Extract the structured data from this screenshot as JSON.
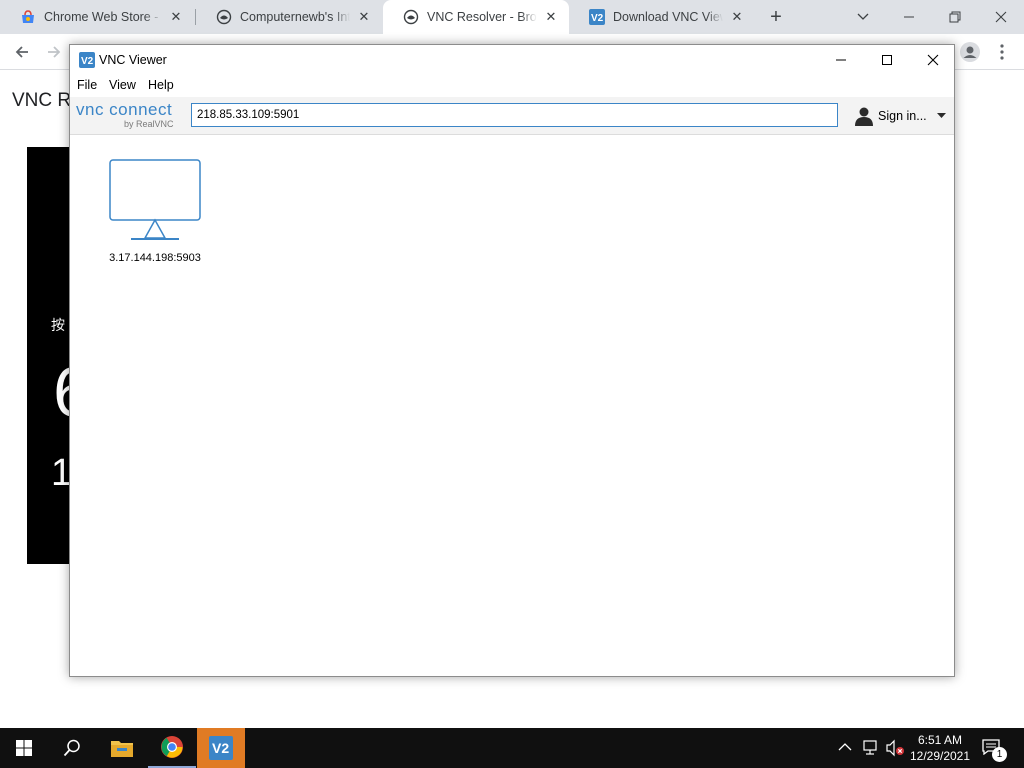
{
  "browser": {
    "tabs": [
      {
        "title": "Chrome Web Store - Extensions",
        "active": false
      },
      {
        "title": "Computernewb's Internet",
        "active": false
      },
      {
        "title": "VNC Resolver - Browse",
        "active": true
      },
      {
        "title": "Download VNC Viewer",
        "active": false
      }
    ],
    "new_tab_label": "+"
  },
  "page": {
    "heading": "VNC R",
    "panel_text_1": "按",
    "panel_text_2": "6",
    "panel_text_3": "1"
  },
  "vnc": {
    "window_title": "VNC Viewer",
    "menu": [
      "File",
      "View",
      "Help"
    ],
    "logo_main": "vnc connect",
    "logo_sub": "by RealVNC",
    "address_value": "218.85.33.109:5901",
    "sign_in_label": "Sign in...",
    "connections": [
      {
        "label": "3.17.144.198:5903"
      }
    ]
  },
  "taskbar": {
    "time": "6:51 AM",
    "date": "12/29/2021",
    "notification_count": "1"
  },
  "colors": {
    "vnc_blue": "#3b85c7",
    "taskbar_active": "#e07b24",
    "chrome_tabstrip": "#dee1e6"
  }
}
